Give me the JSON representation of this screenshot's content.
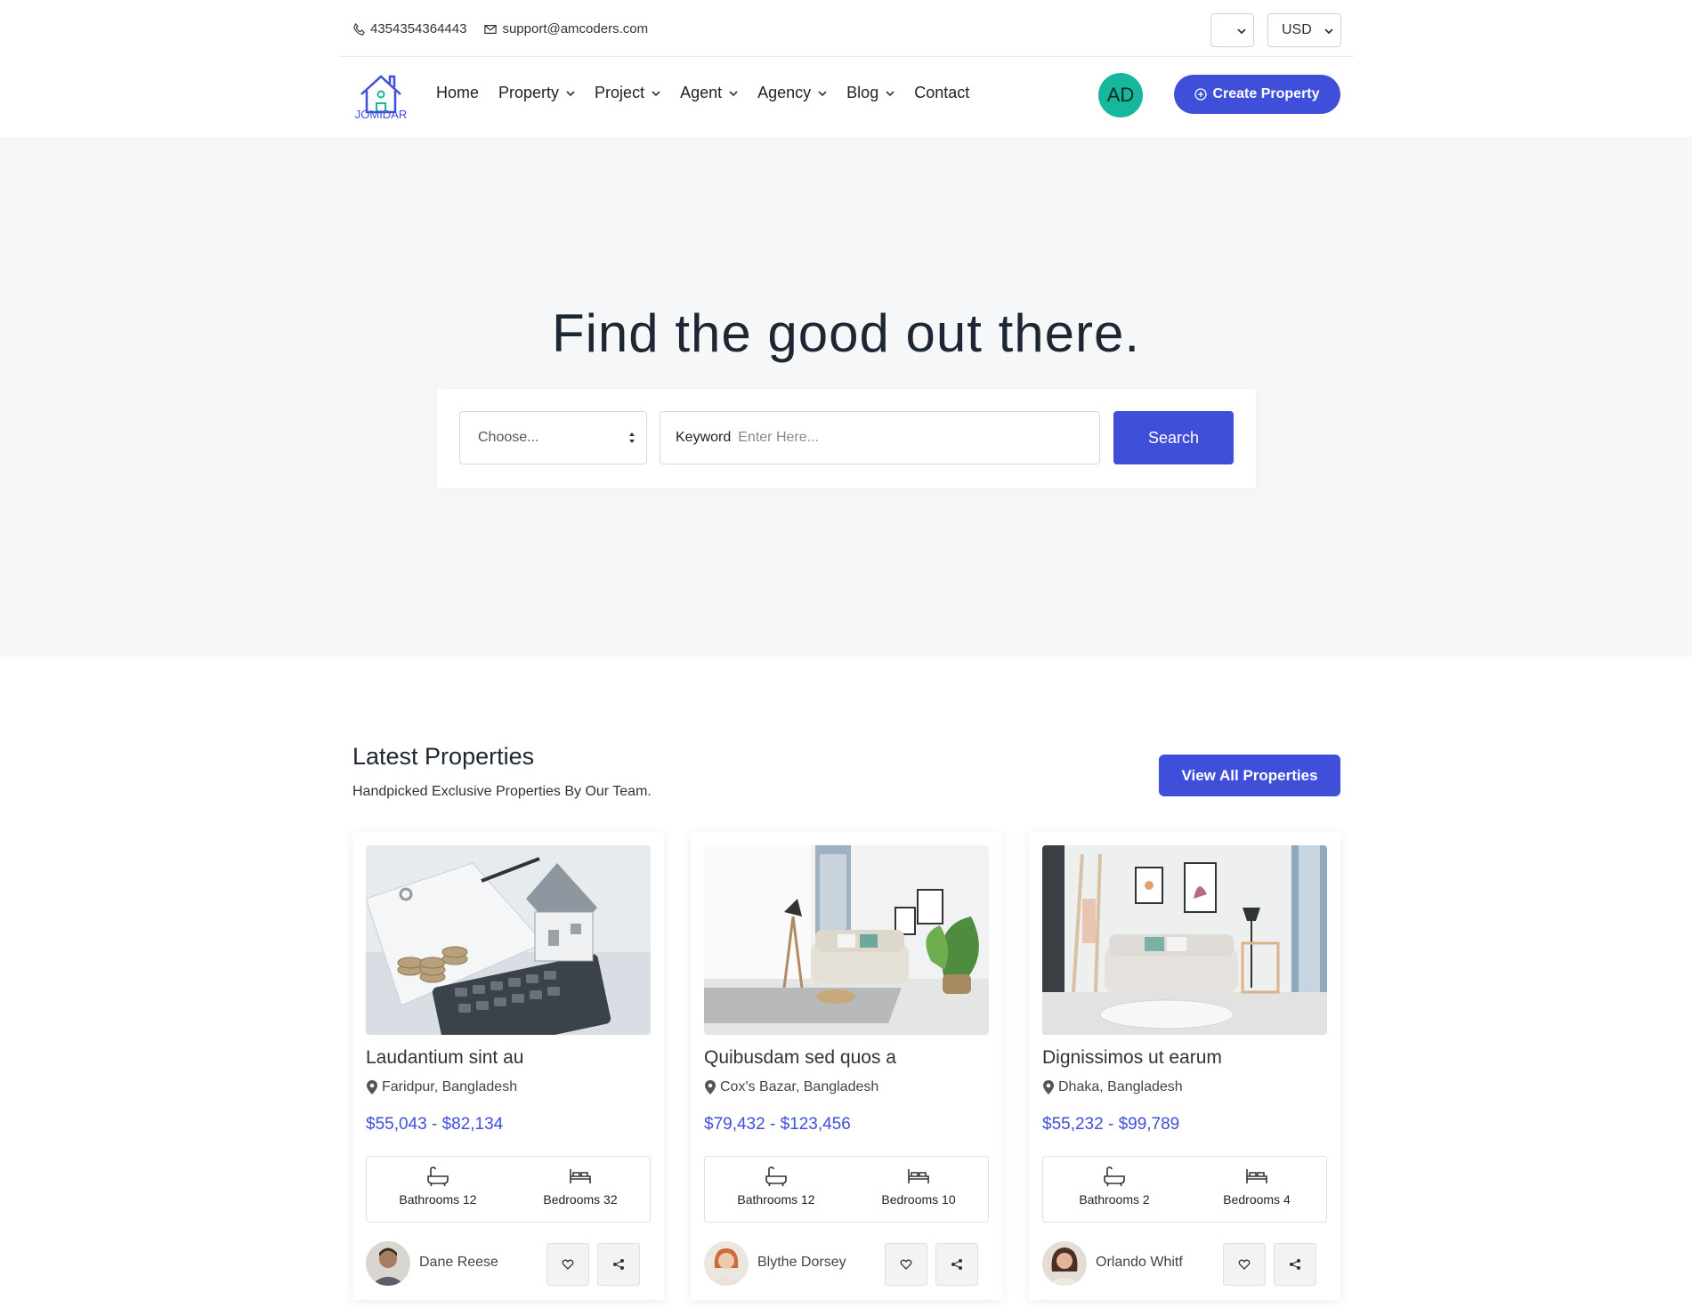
{
  "topbar": {
    "phone": "4354354364443",
    "email": "support@amcoders.com",
    "language_selected": "",
    "currency_selected": "USD"
  },
  "nav": {
    "logo_text": "JOMIDAR",
    "items": [
      {
        "label": "Home",
        "dropdown": false
      },
      {
        "label": "Property",
        "dropdown": true
      },
      {
        "label": "Project",
        "dropdown": true
      },
      {
        "label": "Agent",
        "dropdown": true
      },
      {
        "label": "Agency",
        "dropdown": true
      },
      {
        "label": "Blog",
        "dropdown": true
      },
      {
        "label": "Contact",
        "dropdown": false
      }
    ],
    "user_initials": "AD",
    "create_button": "Create Property"
  },
  "hero": {
    "title": "Find the good out there.",
    "select_value": "Choose...",
    "keyword_label": "Keyword",
    "keyword_placeholder": "Enter Here...",
    "search_button": "Search"
  },
  "latest": {
    "title": "Latest Properties",
    "subtitle": "Handpicked Exclusive Properties By Our Team.",
    "view_all": "View All Properties",
    "cards": [
      {
        "title": "Laudantium sint au",
        "location": "Faridpur, Bangladesh",
        "price": "$55,043 - $82,134",
        "bathrooms": "Bathrooms 12",
        "bedrooms": "Bedrooms 32",
        "agent": "Dane Reese"
      },
      {
        "title": "Quibusdam sed quos a",
        "location": "Cox's Bazar, Bangladesh",
        "price": "$79,432 - $123,456",
        "bathrooms": "Bathrooms 12",
        "bedrooms": "Bedrooms 10",
        "agent": "Blythe Dorsey"
      },
      {
        "title": "Dignissimos ut earum",
        "location": "Dhaka, Bangladesh",
        "price": "$55,232 - $99,789",
        "bathrooms": "Bathrooms 2",
        "bedrooms": "Bedrooms 4",
        "agent": "Orlando Whitf"
      }
    ]
  },
  "colors": {
    "accent": "#3f4fd9",
    "avatar_bg": "#16b79b",
    "hero_bg": "#f6f7f9"
  }
}
